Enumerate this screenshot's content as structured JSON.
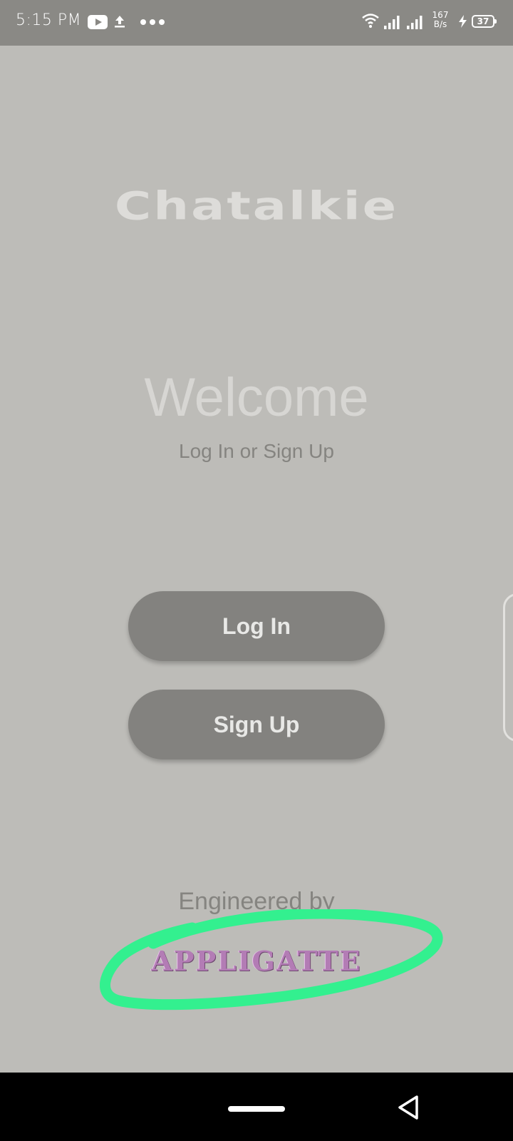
{
  "status_bar": {
    "time": "5:15 PM",
    "net_speed_value": "167",
    "net_speed_unit": "B/s",
    "battery": "37",
    "icons": [
      "youtube-icon",
      "upload-icon",
      "more-dots-icon",
      "wifi-icon",
      "signal-icon",
      "signal-icon",
      "charging-icon",
      "battery-icon"
    ]
  },
  "app": {
    "logo": "Chatalkie",
    "welcome": "Welcome",
    "subtitle": "Log In or Sign Up"
  },
  "buttons": {
    "login": "Log In",
    "signup": "Sign Up"
  },
  "footer": {
    "engineered_by": "Engineered by",
    "brand": "APPLIGATTE",
    "highlight_color": "#33f08f",
    "brand_color": "#b37cb5"
  },
  "colors": {
    "background": "#bdbcb8",
    "status_bar": "#8a8985",
    "button": "#83827f",
    "button_text": "#e8e8e6",
    "nav_bar": "#000000"
  }
}
